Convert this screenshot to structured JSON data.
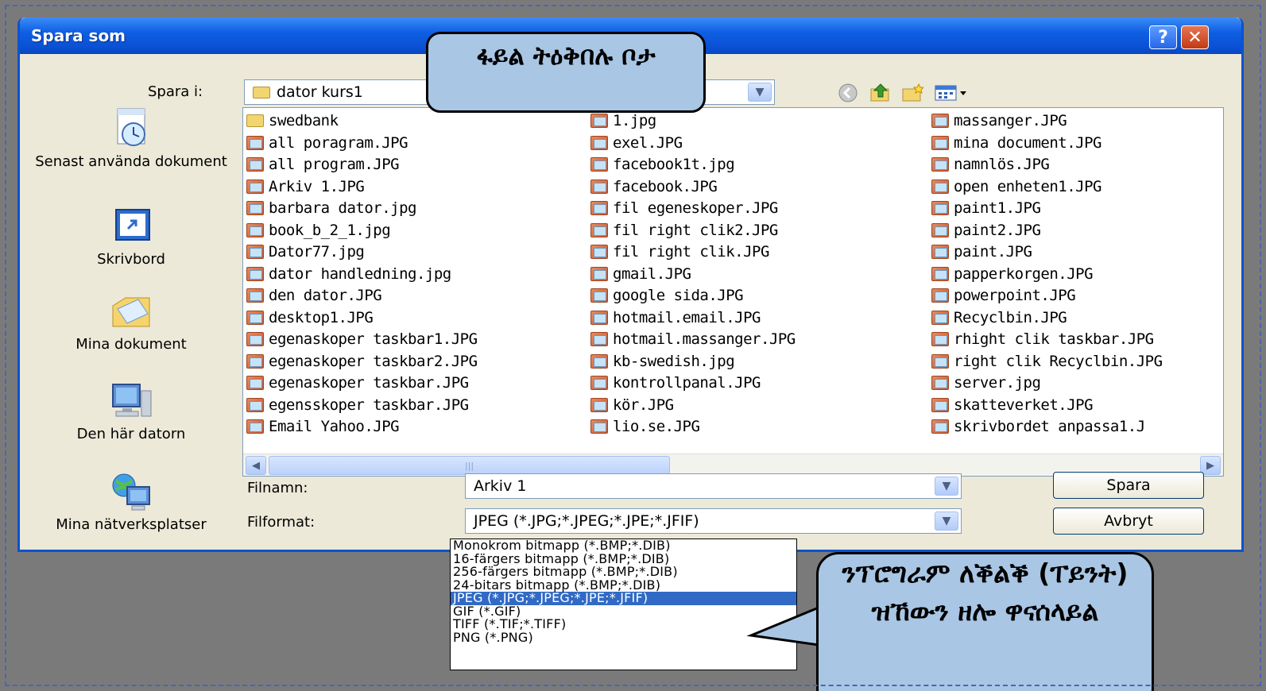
{
  "dialog": {
    "title": "Spara som",
    "help_glyph": "?",
    "close_glyph": "✕"
  },
  "toolbar": {
    "save_in_label": "Spara i:",
    "save_in_value": "dator kurs1"
  },
  "places": [
    {
      "label": "Senast använda dokument",
      "icon": "recent-documents-icon"
    },
    {
      "label": "Skrivbord",
      "icon": "desktop-icon"
    },
    {
      "label": "Mina dokument",
      "icon": "my-documents-icon"
    },
    {
      "label": "Den här datorn",
      "icon": "my-computer-icon"
    },
    {
      "label": "Mina nätverksplatser",
      "icon": "network-places-icon"
    }
  ],
  "files": {
    "col1": [
      "swedbank",
      "all poragram.JPG",
      "all program.JPG",
      "Arkiv 1.JPG",
      "barbara dator.jpg",
      "book_b_2_1.jpg",
      "Dator77.jpg",
      "dator handledning.jpg",
      "den dator.JPG",
      "desktop1.JPG",
      "egenaskoper taskbar1.JPG",
      "egenaskoper taskbar2.JPG",
      "egenaskoper taskbar.JPG",
      "egensskoper taskbar.JPG",
      "Email Yahoo.JPG"
    ],
    "col2": [
      "1.jpg",
      "exel.JPG",
      "facebook1t.jpg",
      "facebook.JPG",
      "fil egeneskoper.JPG",
      "fil right clik2.JPG",
      "fil right clik.JPG",
      "gmail.JPG",
      "google sida.JPG",
      "hotmail.email.JPG",
      "hotmail.massanger.JPG",
      "kb-swedish.jpg",
      "kontrollpanal.JPG",
      "kör.JPG",
      "lio.se.JPG"
    ],
    "col3": [
      "massanger.JPG",
      "mina document.JPG",
      "namnlös.JPG",
      "open enheten1.JPG",
      "paint1.JPG",
      "paint2.JPG",
      "paint.JPG",
      "papperkorgen.JPG",
      "powerpoint.JPG",
      "Recyclbin.JPG",
      "rhight clik taskbar.JPG",
      "right clik Recyclbin.JPG",
      "server.jpg",
      "skatteverket.JPG",
      "skrivbordet anpassa1.J"
    ]
  },
  "form": {
    "filename_label": "Filnamn:",
    "filename_value": "Arkiv 1",
    "format_label": "Filformat:",
    "format_value": "JPEG (*.JPG;*.JPEG;*.JPE;*.JFIF)",
    "save_button": "Spara",
    "cancel_button": "Avbryt"
  },
  "format_options": [
    "Monokrom bitmapp (*.BMP;*.DIB)",
    "16-färgers bitmapp (*.BMP;*.DIB)",
    "256-färgers bitmapp (*.BMP;*.DIB)",
    "24-bitars bitmapp (*.BMP;*.DIB)",
    "JPEG (*.JPG;*.JPEG;*.JPE;*.JFIF)",
    "GIF (*.GIF)",
    "TIFF (*.TIF;*.TIFF)",
    "PNG (*.PNG)"
  ],
  "selected_format_index": 4,
  "callouts": {
    "top": "ፋይል ትዕቅበሉ ቦታ",
    "bottom": "ንፕሮግራም ለቕልቕ (ፐይንት) ዝኸውን ዘሎ ዋናሰላይል"
  }
}
